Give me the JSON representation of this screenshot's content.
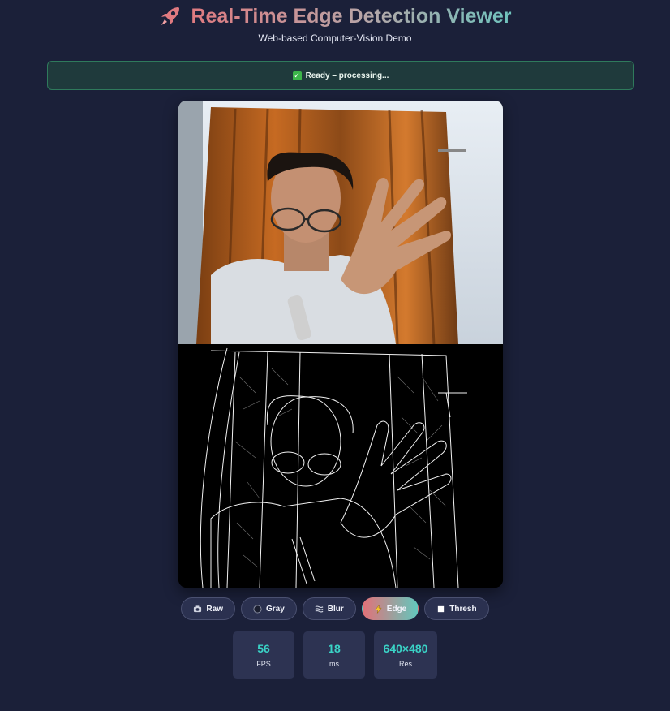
{
  "header": {
    "title": "Real-Time Edge Detection Viewer",
    "subtitle": "Web-based Computer-Vision Demo",
    "icon": "rocket-icon"
  },
  "status": {
    "icon": "check-icon",
    "text": "Ready – processing..."
  },
  "viewer": {
    "raw_feed": "camera-feed",
    "edge_feed": "edge-detected-feed"
  },
  "modes": [
    {
      "label": "Raw",
      "icon": "camera-icon",
      "active": false
    },
    {
      "label": "Gray",
      "icon": "circle-icon",
      "active": false
    },
    {
      "label": "Blur",
      "icon": "waves-icon",
      "active": false
    },
    {
      "label": "Edge",
      "icon": "lightning-icon",
      "active": true
    },
    {
      "label": "Thresh",
      "icon": "square-icon",
      "active": false
    }
  ],
  "stats": [
    {
      "value": "56",
      "label": "FPS"
    },
    {
      "value": "18",
      "label": "ms"
    },
    {
      "value": "640×480",
      "label": "Res"
    }
  ],
  "colors": {
    "background": "#1b2039",
    "accent_teal": "#3ad3c6",
    "accent_pink": "#e37178",
    "status_bg": "#1f3a3c"
  }
}
